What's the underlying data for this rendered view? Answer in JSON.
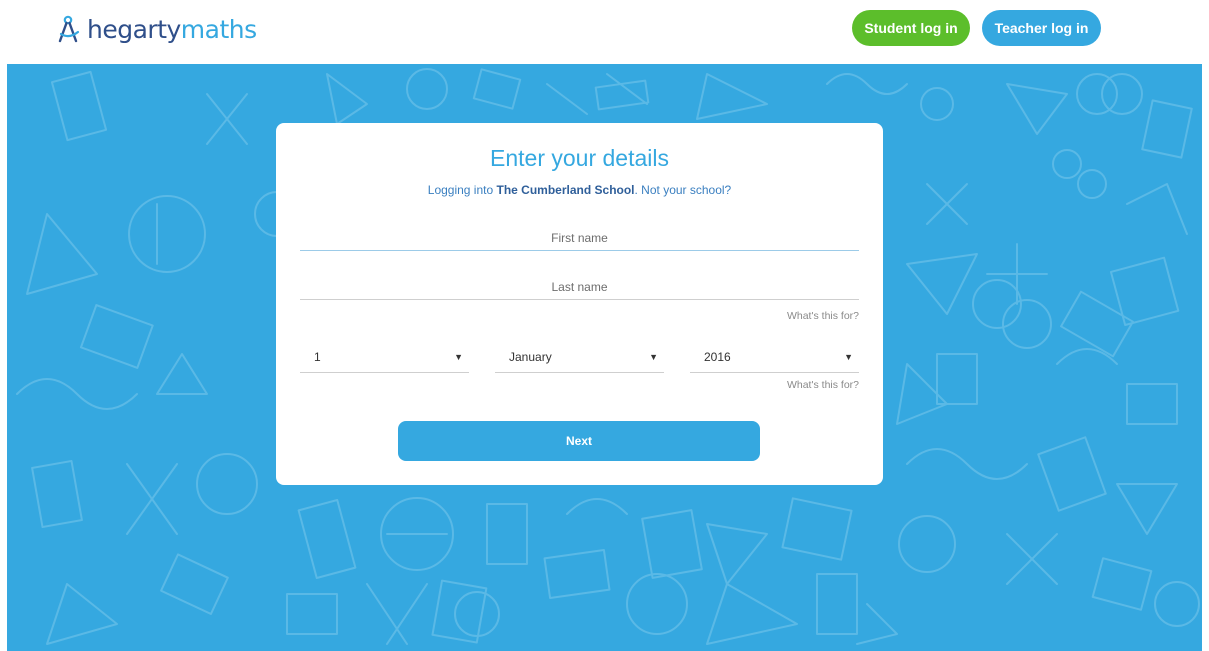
{
  "header": {
    "logo_part1": "hegarty",
    "logo_part2": "maths",
    "logo_icon": "compass-icon",
    "student_login": "Student log in",
    "teacher_login": "Teacher log in"
  },
  "form": {
    "title": "Enter your details",
    "subtitle_prefix": "Logging into ",
    "school_name": "The Cumberland School",
    "subtitle_suffix": ". Not your school?",
    "first_name_placeholder": "First name",
    "last_name_placeholder": "Last name",
    "help_link_1": "What's this for?",
    "dob_day": "1",
    "dob_month": "January",
    "dob_year": "2016",
    "help_link_2": "What's this for?",
    "next_label": "Next"
  },
  "colors": {
    "brand_blue": "#35a8e0",
    "brand_navy": "#2f4f8a",
    "student_green": "#5cbe2b"
  }
}
